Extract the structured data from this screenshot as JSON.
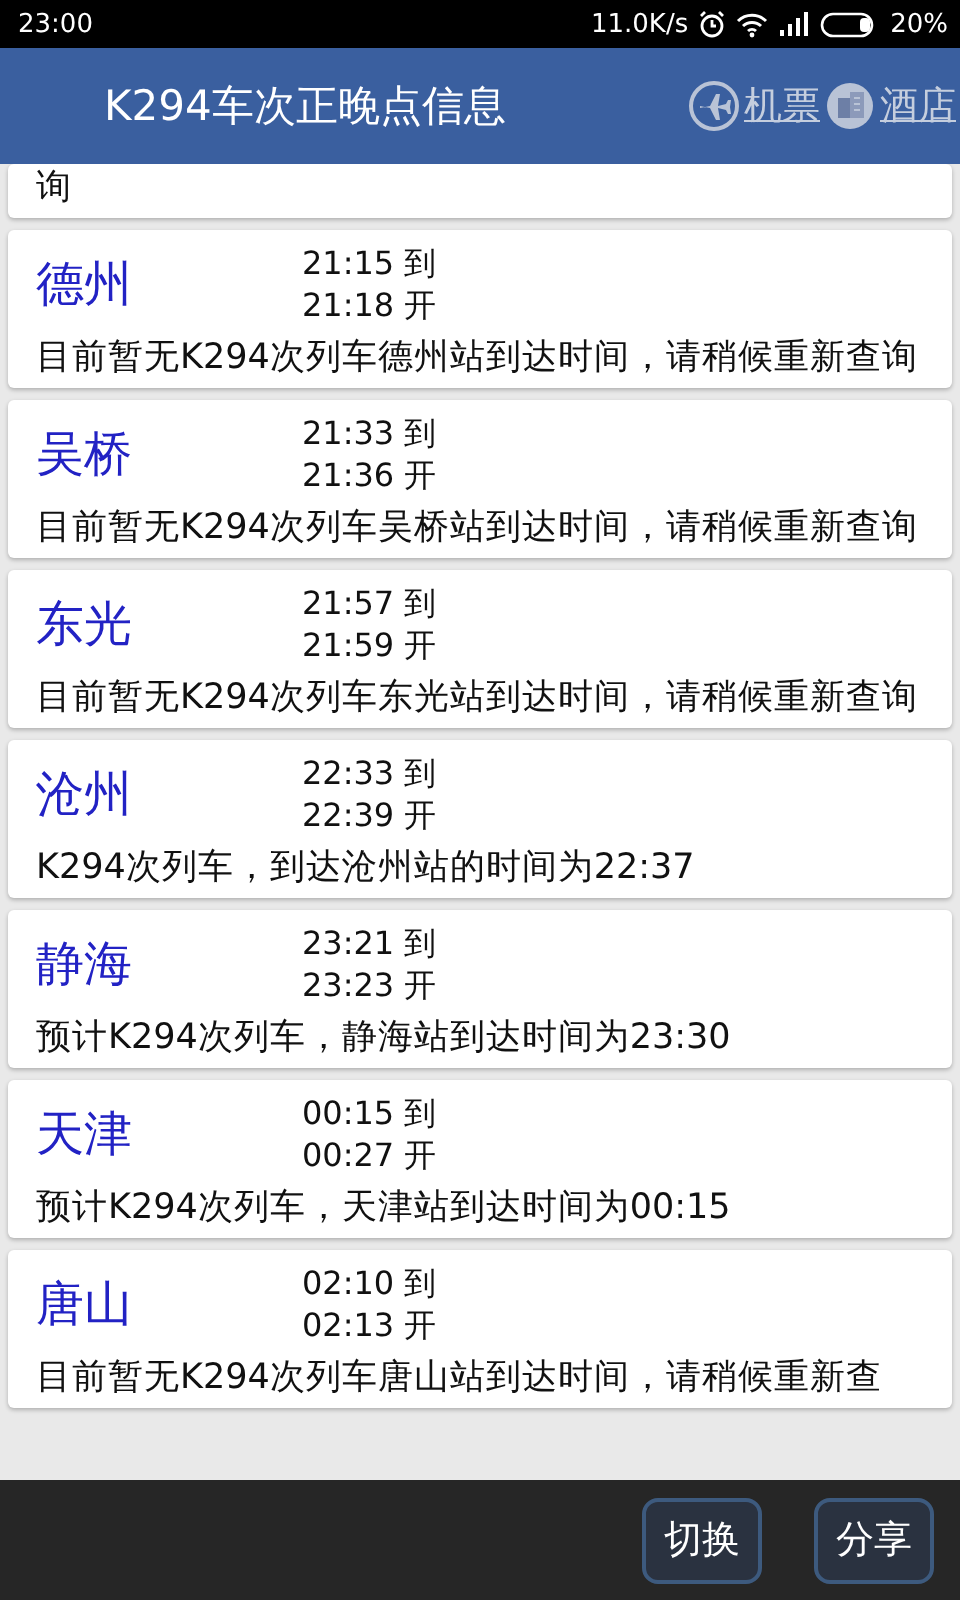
{
  "status_bar": {
    "time": "23:00",
    "speed": "11.0K/s",
    "battery": "20%"
  },
  "header": {
    "title": "K294车次正晚点信息",
    "links": [
      {
        "label": "机票",
        "kind": "flight"
      },
      {
        "label": "酒店",
        "kind": "hotel"
      }
    ]
  },
  "stations": [
    {
      "kind": "partial",
      "message": "询"
    },
    {
      "kind": "full",
      "name": "德州",
      "arrive": "21:15 到",
      "depart": "21:18 开",
      "message": "目前暂无K294次列车德州站到达时间，请稍候重新查询"
    },
    {
      "kind": "full",
      "name": "吴桥",
      "arrive": "21:33 到",
      "depart": "21:36 开",
      "message": "目前暂无K294次列车吴桥站到达时间，请稍候重新查询"
    },
    {
      "kind": "full",
      "name": "东光",
      "arrive": "21:57 到",
      "depart": "21:59 开",
      "message": "目前暂无K294次列车东光站到达时间，请稍候重新查询"
    },
    {
      "kind": "full",
      "name": "沧州",
      "arrive": "22:33 到",
      "depart": "22:39 开",
      "message": "K294次列车，到达沧州站的时间为22:37"
    },
    {
      "kind": "full",
      "name": "静海",
      "arrive": "23:21 到",
      "depart": "23:23 开",
      "message": "预计K294次列车，静海站到达时间为23:30"
    },
    {
      "kind": "full",
      "name": "天津",
      "arrive": "00:15 到",
      "depart": "00:27 开",
      "message": "预计K294次列车，天津站到达时间为00:15"
    },
    {
      "kind": "full",
      "name": "唐山",
      "arrive": "02:10 到",
      "depart": "02:13 开",
      "message": "目前暂无K294次列车唐山站到达时间，请稍候重新查"
    }
  ],
  "bottom_buttons": [
    "切换",
    "分享"
  ]
}
